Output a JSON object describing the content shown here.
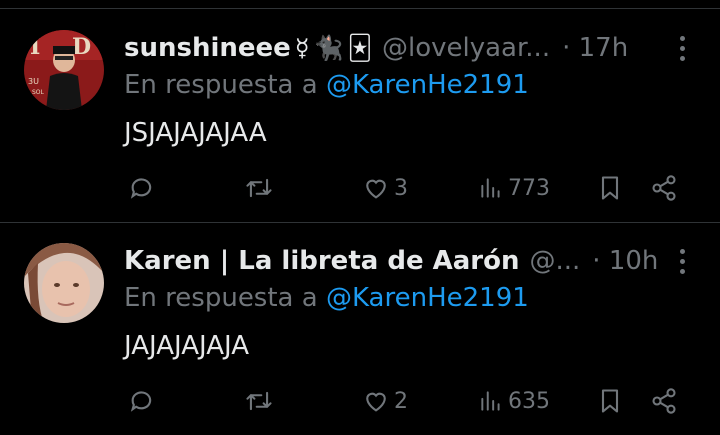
{
  "tweets": [
    {
      "display_name": "sunshineee",
      "emojis": [
        "☿",
        "🐈‍⬛",
        "🃏"
      ],
      "handle": "@lovelyaar...",
      "time": "· 17h",
      "reply_prefix": "En respuesta a",
      "reply_to": "@KarenHe2191",
      "text": "JSJAJAJAJAA",
      "likes": "3",
      "views": "773"
    },
    {
      "display_name": "Karen | La libreta de Aarón",
      "emojis": [],
      "handle": "@...",
      "time": "· 10h",
      "reply_prefix": "En respuesta a",
      "reply_to": "@KarenHe2191",
      "text": "JAJAJAJAJA",
      "likes": "2",
      "views": "635"
    }
  ],
  "colors": {
    "background": "#000000",
    "text_primary": "#e7e9ea",
    "text_secondary": "#71767b",
    "link": "#1d9bf0",
    "divider": "#2f3336"
  },
  "icons": {
    "reply": "reply-icon",
    "retweet": "retweet-icon",
    "like": "heart-icon",
    "views": "views-icon",
    "bookmark": "bookmark-icon",
    "share": "share-icon",
    "more": "more-icon"
  }
}
